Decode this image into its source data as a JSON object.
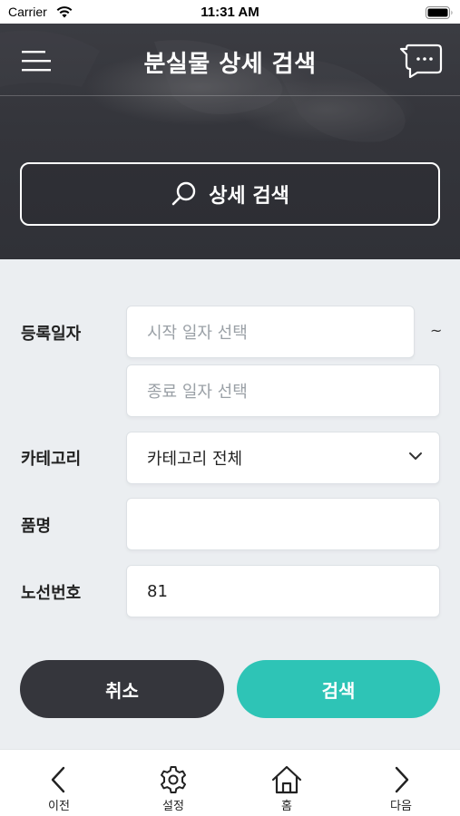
{
  "status_bar": {
    "carrier": "Carrier",
    "time": "11:31 AM"
  },
  "header": {
    "title": "분실물 상세 검색",
    "menu_icon": "hamburger-menu-icon",
    "chat_icon": "chat-bubble-icon"
  },
  "search_banner": {
    "label": "상세 검색",
    "icon": "search-icon"
  },
  "form": {
    "date": {
      "label": "등록일자",
      "start_placeholder": "시작 일자 선택",
      "end_placeholder": "종료 일자 선택",
      "separator": "~"
    },
    "category": {
      "label": "카테고리",
      "selected": "카테고리 전체"
    },
    "item_name": {
      "label": "품명",
      "value": ""
    },
    "route_number": {
      "label": "노선번호",
      "value": "81"
    }
  },
  "actions": {
    "cancel_label": "취소",
    "search_label": "검색"
  },
  "bottom_nav": {
    "items": [
      {
        "label": "이전",
        "icon": "chevron-left-icon"
      },
      {
        "label": "설정",
        "icon": "gear-icon"
      },
      {
        "label": "홈",
        "icon": "home-icon"
      },
      {
        "label": "다음",
        "icon": "chevron-right-icon"
      }
    ]
  },
  "colors": {
    "accent": "#2ec4b6",
    "dark": "#35363c",
    "background": "#ebeef1"
  }
}
